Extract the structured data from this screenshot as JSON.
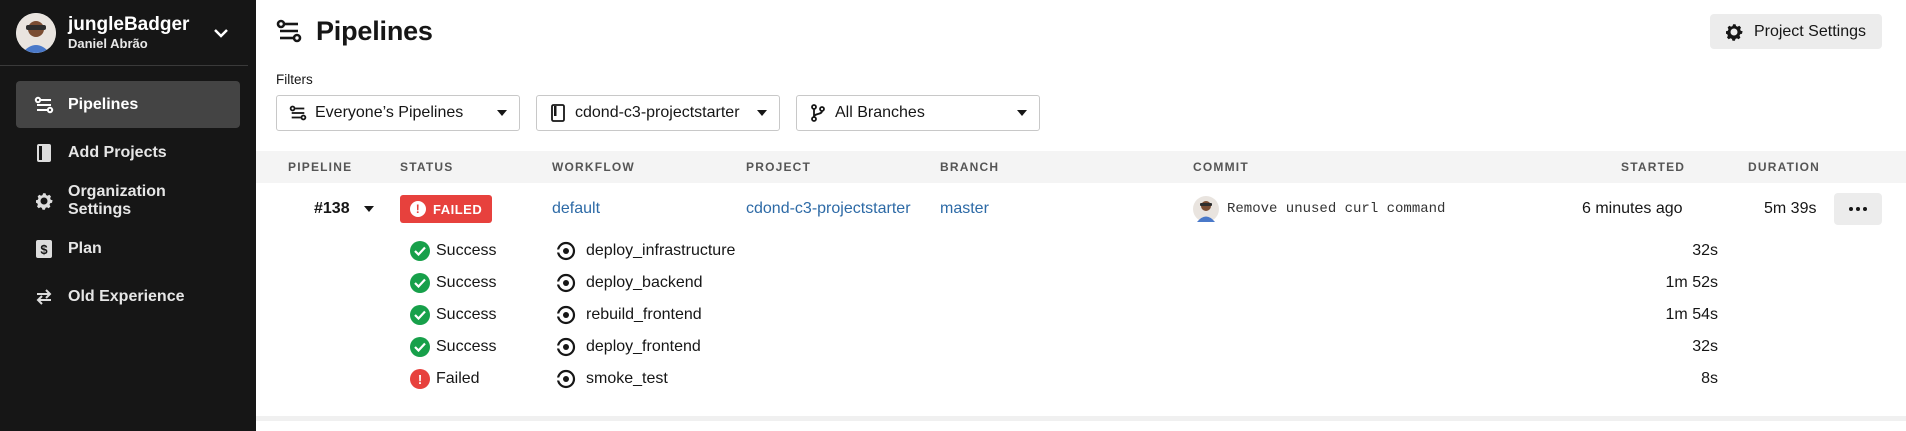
{
  "user": {
    "name": "jungleBadger",
    "subtitle": "Daniel Abrão"
  },
  "sidebar": {
    "items": [
      {
        "label": "Pipelines",
        "icon": "pipelines-icon",
        "active": true
      },
      {
        "label": "Add Projects",
        "icon": "book-icon"
      },
      {
        "label": "Organization Settings",
        "icon": "gear-icon"
      },
      {
        "label": "Plan",
        "icon": "dollar-icon"
      },
      {
        "label": "Old Experience",
        "icon": "swap-icon"
      }
    ]
  },
  "header": {
    "title": "Pipelines",
    "settings_label": "Project Settings"
  },
  "filters": {
    "label": "Filters",
    "pipelines": "Everyone’s Pipelines",
    "project": "cdond-c3-projectstarter",
    "branch": "All Branches"
  },
  "table": {
    "headers": {
      "pipeline": "PIPELINE",
      "status": "STATUS",
      "workflow": "WORKFLOW",
      "project": "PROJECT",
      "branch": "BRANCH",
      "commit": "COMMIT",
      "started": "STARTED",
      "duration": "DURATION"
    },
    "row": {
      "pipeline": "#138",
      "status": "FAILED",
      "workflow": "default",
      "project": "cdond-c3-projectstarter",
      "branch": "master",
      "commit": "Remove unused curl command",
      "started": "6 minutes ago",
      "duration": "5m 39s"
    },
    "jobs": [
      {
        "status": "Success",
        "name": "deploy_infrastructure",
        "duration": "32s"
      },
      {
        "status": "Success",
        "name": "deploy_backend",
        "duration": "1m 52s"
      },
      {
        "status": "Success",
        "name": "rebuild_frontend",
        "duration": "1m 54s"
      },
      {
        "status": "Success",
        "name": "deploy_frontend",
        "duration": "32s"
      },
      {
        "status": "Failed",
        "name": "smoke_test",
        "duration": "8s"
      }
    ]
  },
  "colors": {
    "sidebar": "#161616",
    "failed": "#e7413d",
    "success": "#17a04a",
    "link": "#2d6aa6"
  }
}
